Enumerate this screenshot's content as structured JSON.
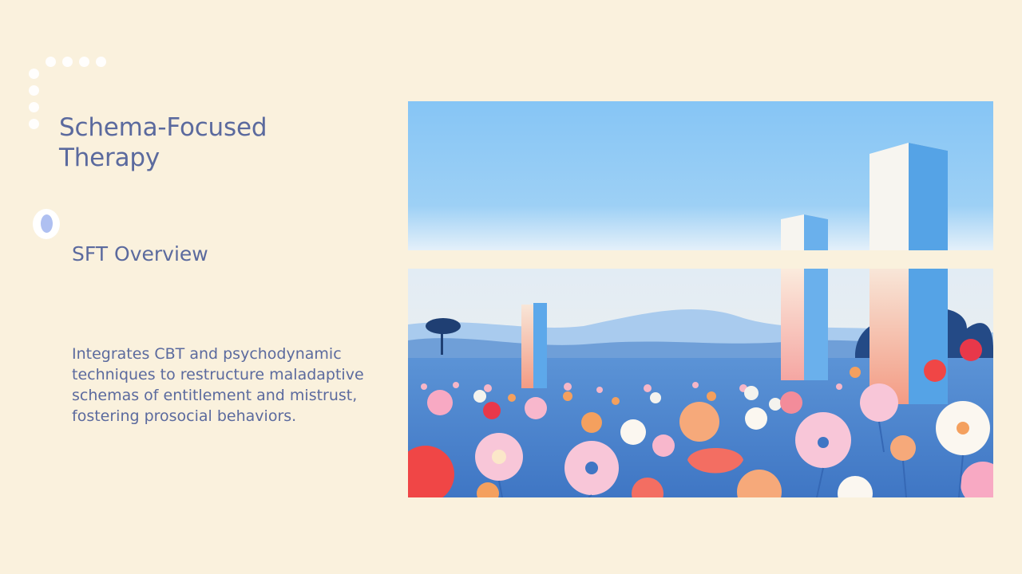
{
  "slide": {
    "title": "Schema-Focused Therapy",
    "subtitle": "SFT Overview",
    "body": "Integrates CBT and psychodynamic techniques to restructure maladaptive schemas of entitlement and mistrust, fostering prosocial behaviors."
  },
  "colors": {
    "background": "#FAF1DD",
    "text": "#5B6A9E",
    "accent": "#AFC0F1",
    "sky": "#8EC6F2"
  },
  "image": {
    "icon": "flower-field-with-pillars-illustration"
  }
}
